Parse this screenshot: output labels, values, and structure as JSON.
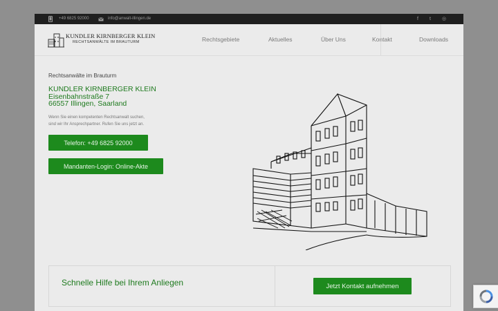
{
  "topbar": {
    "phone": "+49 6825 92000",
    "email": "info@anwalt-illingen.de",
    "social": {
      "facebook": "f",
      "twitter": "t",
      "other": "◎"
    }
  },
  "logo": {
    "title": "KUNDLER KIRNBERGER KLEIN",
    "subtitle": "RECHTSANWÄLTE IM BRAUTURM"
  },
  "nav": [
    "Rechtsgebiete",
    "Aktuelles",
    "Über Uns",
    "Kontakt",
    "Downloads"
  ],
  "hero": {
    "tagline": "Rechtsanwälte im Brauturm",
    "firm_name": "KUNDLER KIRNBERGER KLEIN",
    "street": "Eisenbahnstraße 7",
    "city": "66557 Illingen, Saarland",
    "intro_line1": "Wenn Sie einen kompetenten Rechtsanwalt suchen,",
    "intro_line2": "sind wir Ihr Ansprechpartner. Rufen Sie uns jetzt an.",
    "phone_button": "Telefon: +49 6825 92000",
    "login_button": "Mandanten-Login: Online-Akte"
  },
  "cta": {
    "heading": "Schnelle Hilfe bei Ihrem Anliegen",
    "button": "Jetzt Kontakt aufnehmen"
  },
  "colors": {
    "accent": "#1d8a1d",
    "text_green": "#1e7a1e",
    "overlay": "#8f8f8f",
    "topbar": "#1f1f1f"
  }
}
